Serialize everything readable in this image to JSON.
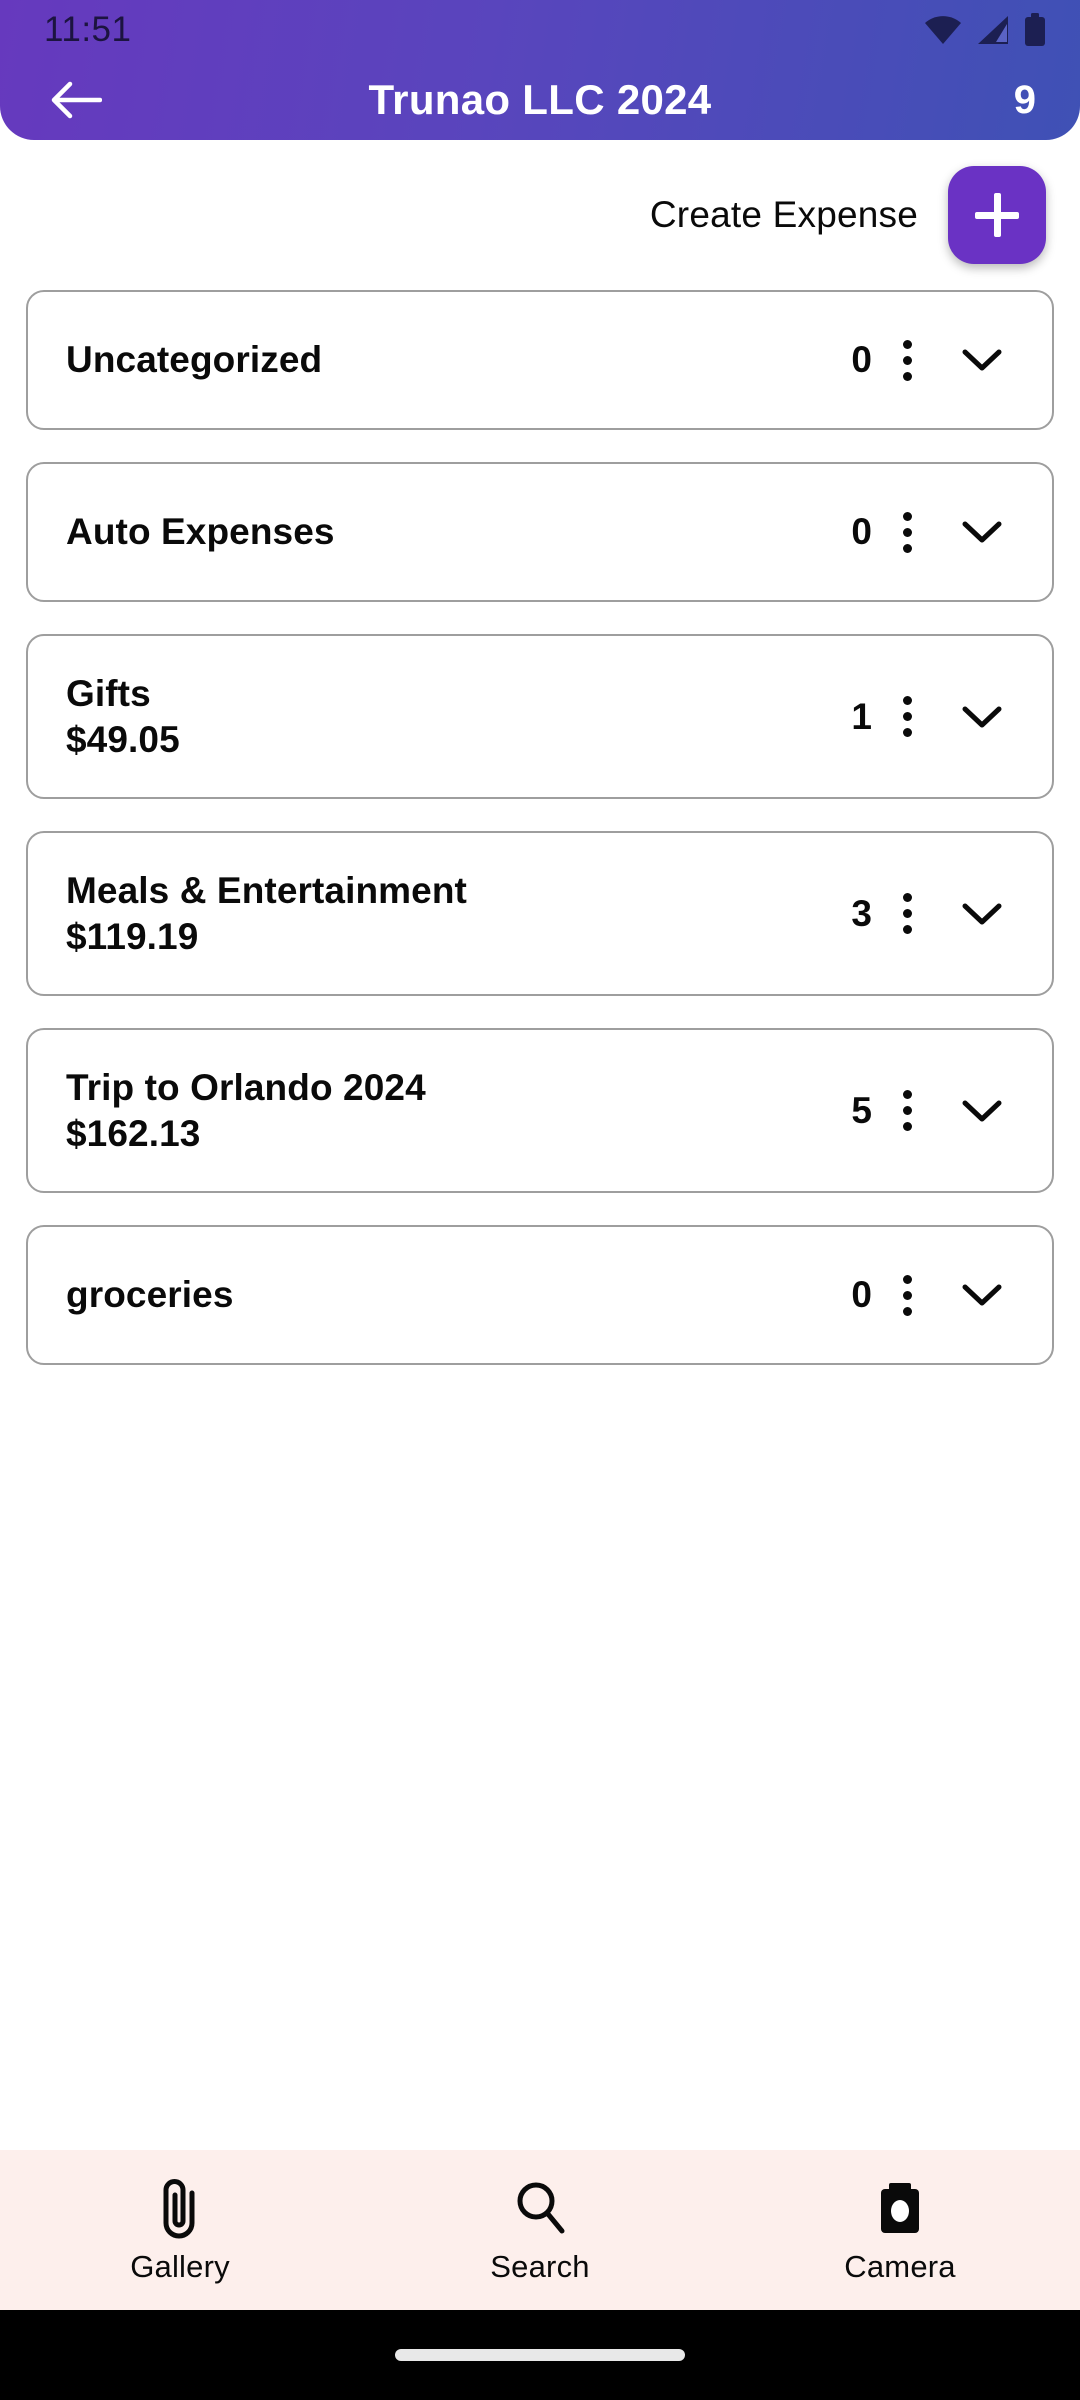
{
  "status_bar": {
    "time": "11:51",
    "icons": [
      "wifi-icon",
      "cellular-signal-icon",
      "battery-icon"
    ]
  },
  "app_bar": {
    "back_icon": "arrow-left-icon",
    "title": "Trunao LLC 2024",
    "count": "9",
    "gradient_start": "#6639be",
    "gradient_end": "#3f51b5"
  },
  "create_expense": {
    "label": "Create Expense",
    "fab_icon": "plus-icon",
    "fab_color": "#6a32c4"
  },
  "categories": [
    {
      "title": "Uncategorized",
      "amount": "",
      "count": "0",
      "menu_icon": "more-vertical-icon",
      "expand_icon": "chevron-down-icon"
    },
    {
      "title": "Auto Expenses",
      "amount": "",
      "count": "0",
      "menu_icon": "more-vertical-icon",
      "expand_icon": "chevron-down-icon"
    },
    {
      "title": "Gifts",
      "amount": "$49.05",
      "count": "1",
      "menu_icon": "more-vertical-icon",
      "expand_icon": "chevron-down-icon"
    },
    {
      "title": "Meals & Entertainment",
      "amount": "$119.19",
      "count": "3",
      "menu_icon": "more-vertical-icon",
      "expand_icon": "chevron-down-icon"
    },
    {
      "title": "Trip to Orlando 2024",
      "amount": "$162.13",
      "count": "5",
      "menu_icon": "more-vertical-icon",
      "expand_icon": "chevron-down-icon"
    },
    {
      "title": "groceries",
      "amount": "",
      "count": "0",
      "menu_icon": "more-vertical-icon",
      "expand_icon": "chevron-down-icon"
    }
  ],
  "bottom_nav": {
    "background": "#fdefec",
    "items": [
      {
        "label": "Gallery",
        "icon": "paperclip-icon"
      },
      {
        "label": "Search",
        "icon": "search-icon"
      },
      {
        "label": "Camera",
        "icon": "camera-icon"
      }
    ]
  }
}
